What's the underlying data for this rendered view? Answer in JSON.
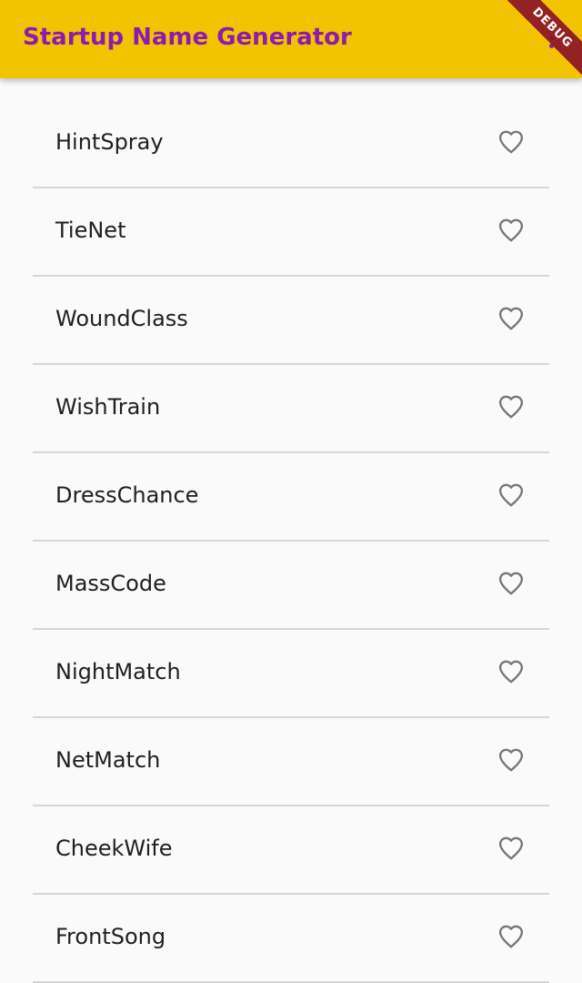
{
  "app_bar": {
    "title": "Startup Name Generator",
    "menu_icon": "more-vert-icon",
    "debug_label": "DEBUG",
    "background_color": "#f2c400",
    "title_color": "#8e1bb0"
  },
  "suggestions": [
    {
      "name": "HintSpray",
      "icon": "favorite-border-icon"
    },
    {
      "name": "TieNet",
      "icon": "favorite-border-icon"
    },
    {
      "name": "WoundClass",
      "icon": "favorite-border-icon"
    },
    {
      "name": "WishTrain",
      "icon": "favorite-border-icon"
    },
    {
      "name": "DressChance",
      "icon": "favorite-border-icon"
    },
    {
      "name": "MassCode",
      "icon": "favorite-border-icon"
    },
    {
      "name": "NightMatch",
      "icon": "favorite-border-icon"
    },
    {
      "name": "NetMatch",
      "icon": "favorite-border-icon"
    },
    {
      "name": "CheekWife",
      "icon": "favorite-border-icon"
    },
    {
      "name": "FrontSong",
      "icon": "favorite-border-icon"
    }
  ]
}
